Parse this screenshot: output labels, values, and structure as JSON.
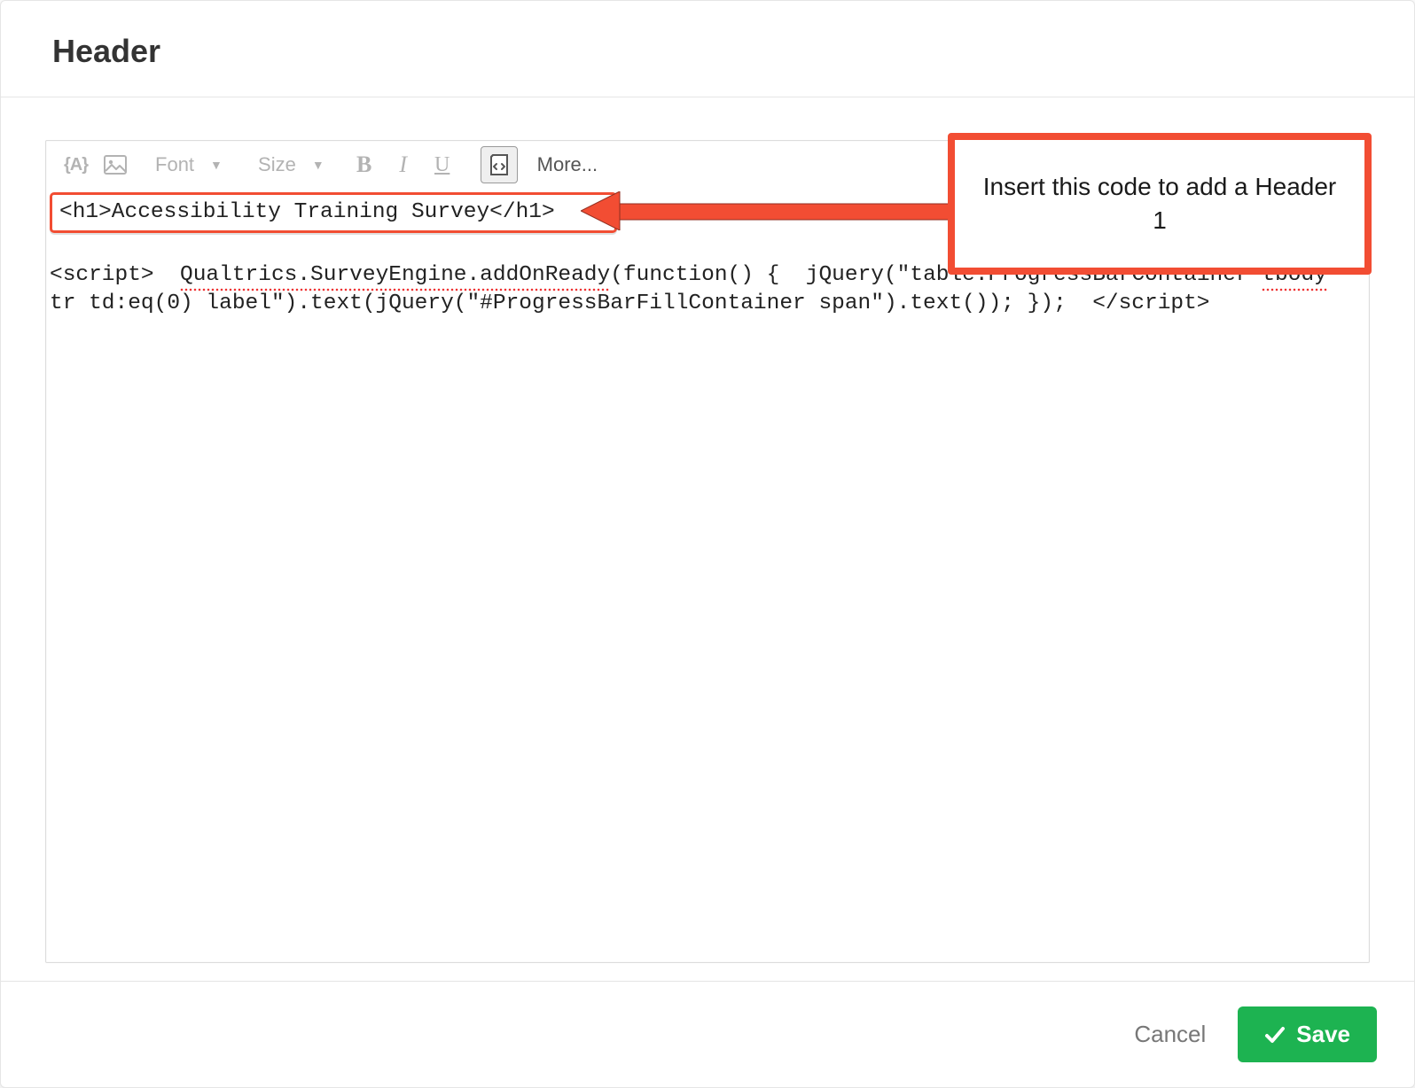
{
  "header": {
    "title": "Header"
  },
  "toolbar": {
    "piped_text_icon": "{A}",
    "font_label": "Font",
    "size_label": "Size",
    "bold_label": "B",
    "italic_label": "I",
    "underline_label": "U",
    "more_label": "More..."
  },
  "editor": {
    "h1_code": "<h1>Accessibility Training Survey</h1>",
    "script_code": "<script>  Qualtrics.SurveyEngine.addOnReady(function() {  jQuery(\"table.ProgressBarContainer tbody tr td:eq(0) label\").text(jQuery(\"#ProgressBarFillContainer span\").text()); });  </script>",
    "spellcheck_words": [
      "Qualtrics.SurveyEngine.addOnReady",
      "tbody"
    ]
  },
  "callout": {
    "text": "Insert this code to add a Header 1"
  },
  "footer": {
    "cancel_label": "Cancel",
    "save_label": "Save"
  },
  "colors": {
    "annotation": "#F24D33",
    "save": "#1db351"
  }
}
